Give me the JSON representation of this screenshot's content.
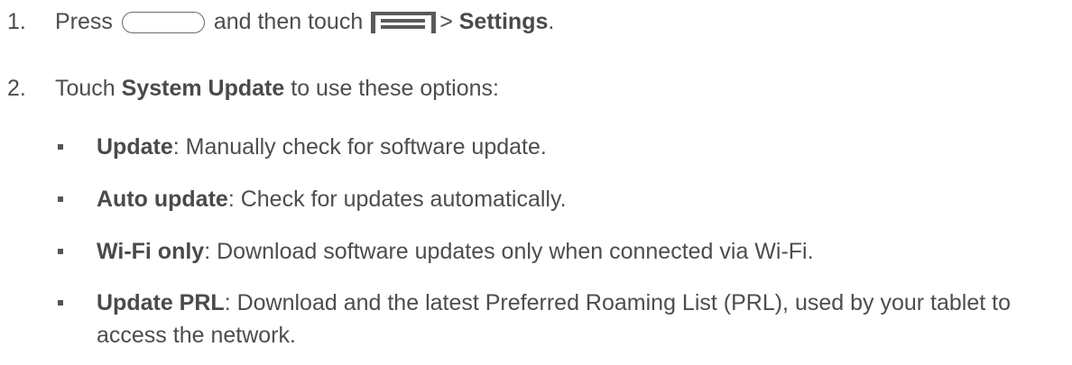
{
  "steps": [
    {
      "number": "1.",
      "press": "Press",
      "and_then": "and then touch",
      "separator": ">",
      "settings": "Settings",
      "period": ".",
      "icons": [
        "home-key-icon",
        "menu-key-icon"
      ]
    },
    {
      "number": "2.",
      "touch": "Touch",
      "system_update": "System Update",
      "rest": "to use these options:"
    }
  ],
  "options": [
    {
      "title": "Update",
      "description": ": Manually check for software update."
    },
    {
      "title": "Auto update",
      "description": ": Check for updates automatically."
    },
    {
      "title": "Wi-Fi only",
      "description": ": Download software updates only when connected via Wi-Fi."
    },
    {
      "title": "Update PRL",
      "description": ": Download and the latest Preferred Roaming List (PRL), used by your tablet to access the network."
    }
  ]
}
